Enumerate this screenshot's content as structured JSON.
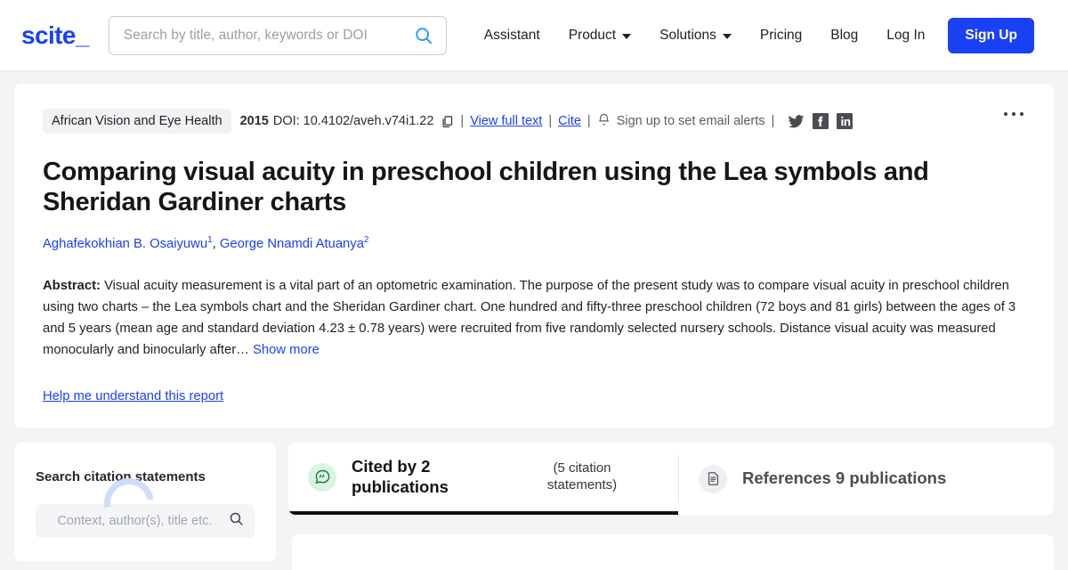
{
  "nav": {
    "logo": "scite_",
    "search_placeholder": "Search by title, author, keywords or DOI",
    "search_value": "",
    "search_icon": "search-icon",
    "links": [
      {
        "label": "Assistant",
        "has_chevron": false
      },
      {
        "label": "Product",
        "has_chevron": true
      },
      {
        "label": "Solutions",
        "has_chevron": true
      },
      {
        "label": "Pricing",
        "has_chevron": false
      },
      {
        "label": "Blog",
        "has_chevron": false
      },
      {
        "label": "Log In",
        "has_chevron": false
      }
    ],
    "signup_label": "Sign Up",
    "signup_color": "#1a41f5"
  },
  "paper": {
    "journal": "African Vision and Eye Health",
    "year": "2015",
    "doi": "DOI: 10.4102/aveh.v74i1.22",
    "copy_icon": "copy-icon",
    "view_full_text": "View full text",
    "cite": "Cite",
    "bell_icon": "bell-icon",
    "email_alerts": "Sign up to set email alerts",
    "separator": "|",
    "socials": [
      "twitter-icon",
      "facebook-icon",
      "linkedin-icon"
    ],
    "title": "Comparing visual acuity in preschool children using the Lea symbols and Sheridan Gardiner charts",
    "authors": [
      {
        "name": "Aghafekokhian B. Osaiyuwu",
        "sup": "1"
      },
      {
        "name": "George Nnamdi Atuanya",
        "sup": "2"
      }
    ],
    "abstract_label": "Abstract:",
    "abstract_body": " Visual acuity measurement is a vital part of an optometric examination. The purpose of the present study was to compare visual acuity in preschool children using two charts – the Lea symbols chart and the Sheridan Gardiner chart. One hundred and fifty-three preschool children (72 boys and 81 girls) between the ages of 3 and 5 years (mean age and standard deviation 4.23 ± 0.78 years) were recruited from five randomly selected nursery schools. Distance visual acuity was measured monocularly and binocularly after… ",
    "show_more": "Show more",
    "help_link": "Help me understand this report",
    "kebab": "more-options-icon"
  },
  "sidebar": {
    "heading": "Search citation statements",
    "search_placeholder": "Context, author(s), title etc.",
    "search_value": "",
    "search_icon": "search-icon",
    "loading": true
  },
  "tabs": [
    {
      "id": "cited-by",
      "icon": "quote-bubble-icon",
      "title": "Cited by 2 publications",
      "subtitle": "(5 citation statements)",
      "active": true
    },
    {
      "id": "references",
      "icon": "document-icon",
      "title": "References 9 publications",
      "subtitle": "",
      "active": false
    }
  ]
}
